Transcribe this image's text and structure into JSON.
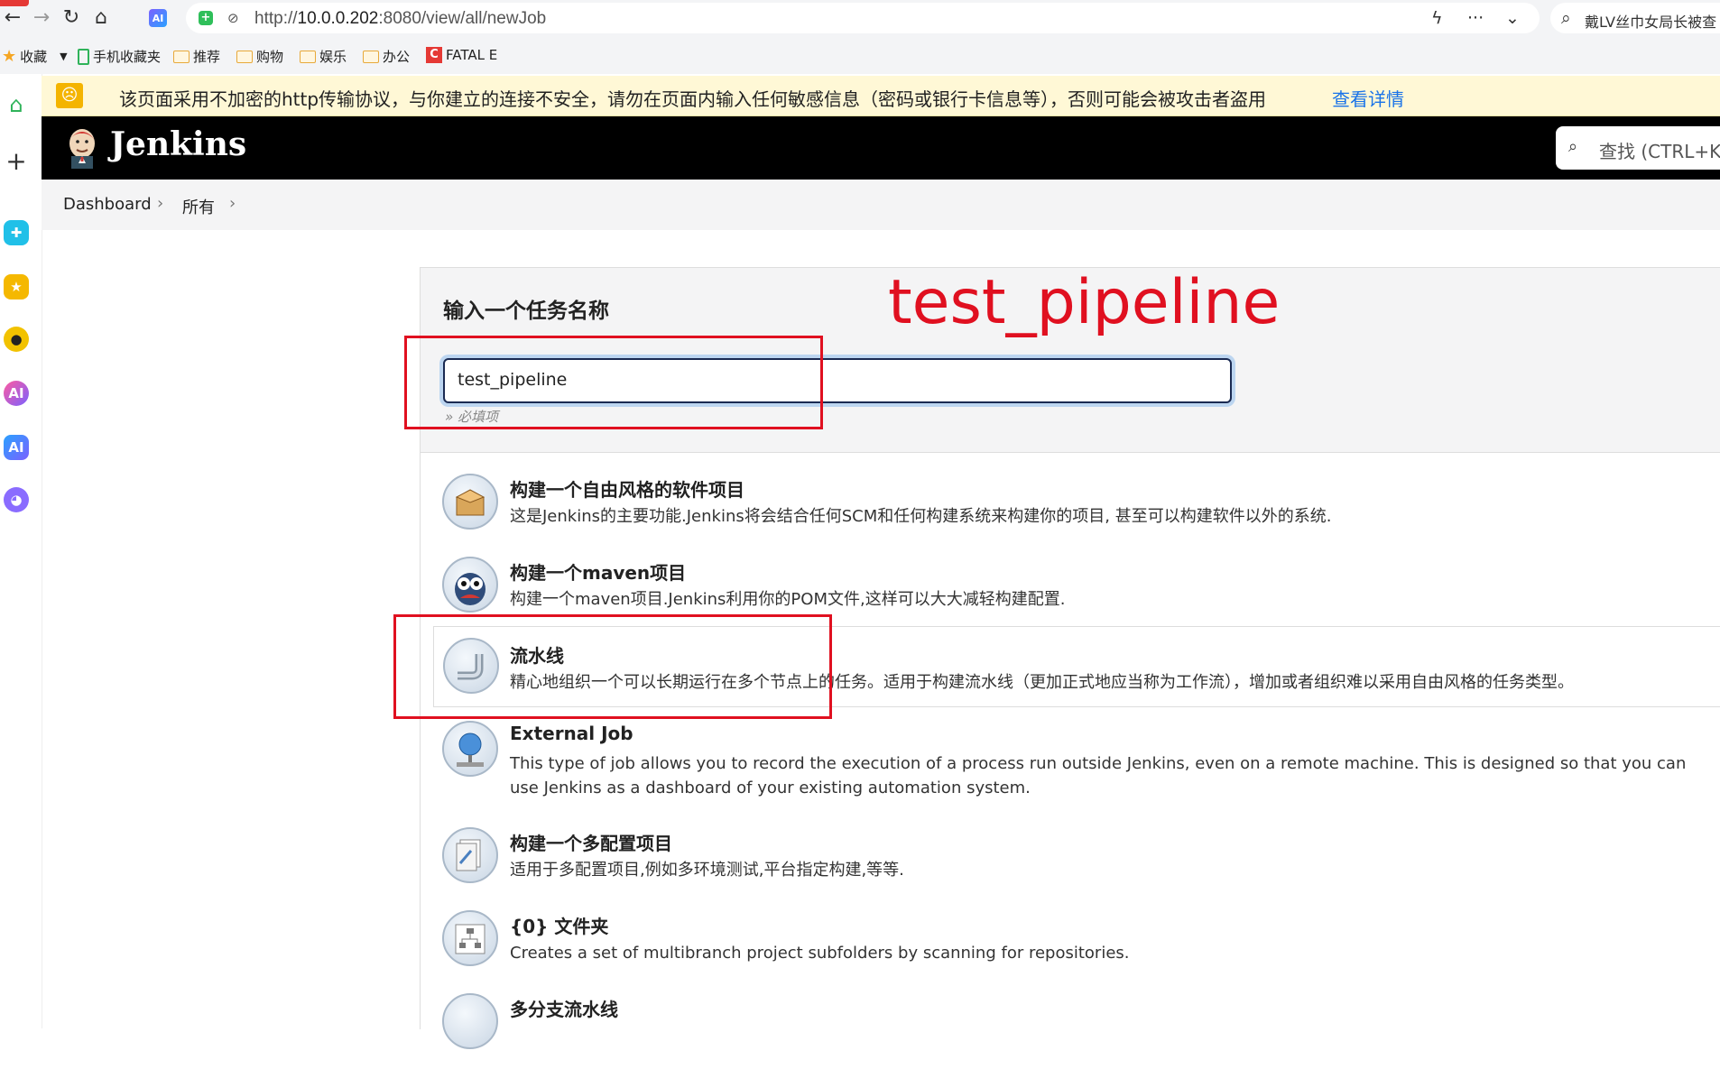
{
  "browser": {
    "url_prefix": "http://",
    "url_host": "10.0.0.202",
    "url_rest": ":8080/view/all/newJob",
    "ai_badge": "AI",
    "search_text": "戴LV丝巾女局长被查"
  },
  "bookmarks": [
    "收藏",
    "手机收藏夹",
    "推荐",
    "购物",
    "娱乐",
    "办公",
    "FATAL E"
  ],
  "warning": {
    "text": "该页面采用不加密的http传输协议，与你建立的连接不安全，请勿在页面内输入任何敏感信息（密码或银行卡信息等），否则可能会被攻击者盗用",
    "link": "查看详情"
  },
  "jenkins": {
    "title": "Jenkins",
    "search_placeholder": "查找 (CTRL+K)"
  },
  "breadcrumb": [
    "Dashboard",
    "所有"
  ],
  "form": {
    "label": "输入一个任务名称",
    "value": "test_pipeline",
    "required_hint": "» 必填项"
  },
  "annotation": "test_pipeline",
  "jobs": [
    {
      "title": "构建一个自由风格的软件项目",
      "desc": "这是Jenkins的主要功能.Jenkins将会结合任何SCM和任何构建系统来构建你的项目, 甚至可以构建软件以外的系统.",
      "icon": "freestyle-box-icon"
    },
    {
      "title": "构建一个maven项目",
      "desc": "构建一个maven项目.Jenkins利用你的POM文件,这样可以大大减轻构建配置.",
      "icon": "maven-owl-icon"
    },
    {
      "title": "流水线",
      "desc": "精心地组织一个可以长期运行在多个节点上的任务。适用于构建流水线（更加正式地应当称为工作流），增加或者组织难以采用自由风格的任务类型。",
      "icon": "pipeline-pipe-icon"
    },
    {
      "title": "External Job",
      "desc": "This type of job allows you to record the execution of a process run outside Jenkins, even on a remote machine. This is designed so that you can use Jenkins as a dashboard of your existing automation system.",
      "icon": "external-globe-icon"
    },
    {
      "title": "构建一个多配置项目",
      "desc": "适用于多配置项目,例如多环境测试,平台指定构建,等等.",
      "icon": "multi-config-icon"
    },
    {
      "title": "{0} 文件夹",
      "desc": "Creates a set of multibranch project subfolders by scanning for repositories.",
      "icon": "folder-org-icon"
    },
    {
      "title": "多分支流水线",
      "desc": "",
      "icon": "multibranch-pipeline-icon"
    }
  ],
  "colors": {
    "accent_red": "#e01020",
    "link_blue": "#1a73e8",
    "header_black": "#000000"
  }
}
